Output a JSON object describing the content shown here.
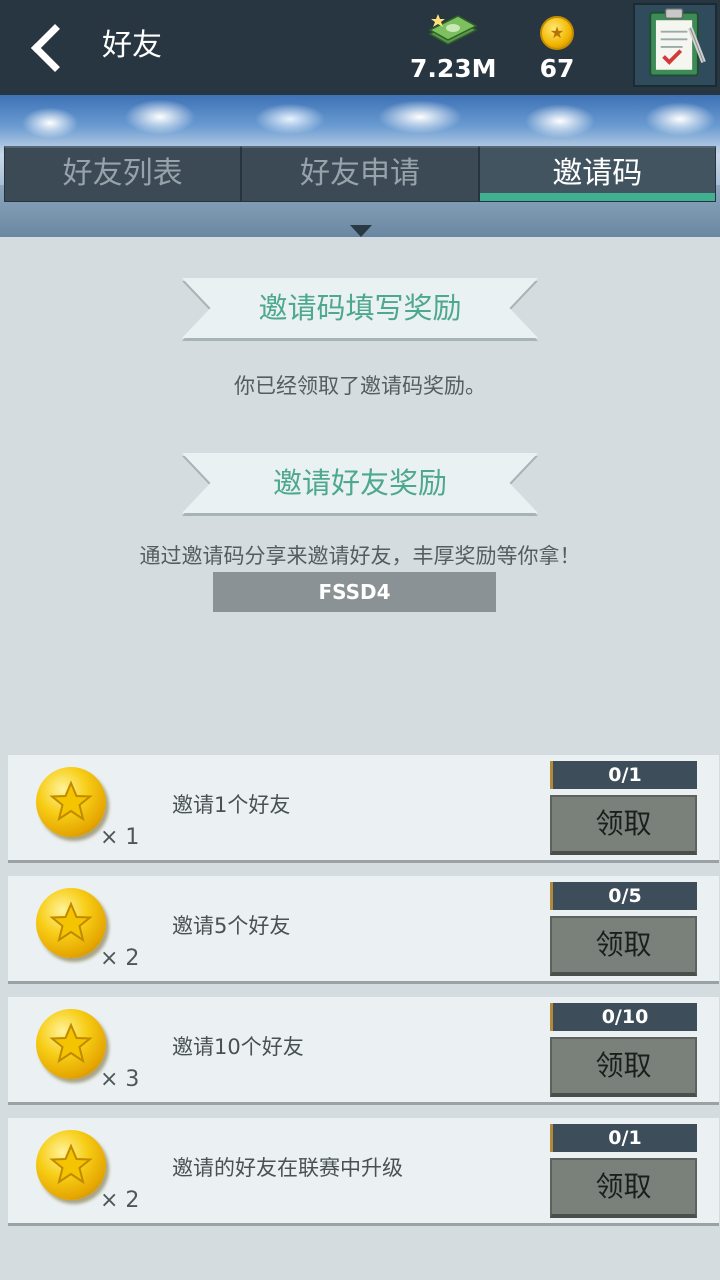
{
  "header": {
    "title": "好友",
    "cash": "7.23M",
    "coins": "67"
  },
  "tabs": [
    {
      "label": "好友列表"
    },
    {
      "label": "好友申请"
    },
    {
      "label": "邀请码",
      "active": true
    }
  ],
  "invite_code_section": {
    "title": "邀请码填写奖励",
    "message": "你已经领取了邀请码奖励。"
  },
  "invite_friends_section": {
    "title": "邀请好友奖励",
    "message": "通过邀请码分享来邀请好友，丰厚奖励等你拿！",
    "code": "FSSD4"
  },
  "rewards": [
    {
      "multiplier": "× 1",
      "label": "邀请1个好友",
      "progress": "0/1",
      "button": "领取"
    },
    {
      "multiplier": "× 2",
      "label": "邀请5个好友",
      "progress": "0/5",
      "button": "领取"
    },
    {
      "multiplier": "× 3",
      "label": "邀请10个好友",
      "progress": "0/10",
      "button": "领取"
    },
    {
      "multiplier": "× 2",
      "label": "邀请的好友在联赛中升级",
      "progress": "0/1",
      "button": "领取"
    }
  ],
  "icons": {
    "back": "chevron-left-icon",
    "cash": "cash-stack-icon",
    "coin": "gold-coin-icon",
    "clipboard": "clipboard-icon"
  },
  "colors": {
    "header_bg": "#283641",
    "accent_green": "#3fb090",
    "ribbon_text": "#4ea88c"
  }
}
